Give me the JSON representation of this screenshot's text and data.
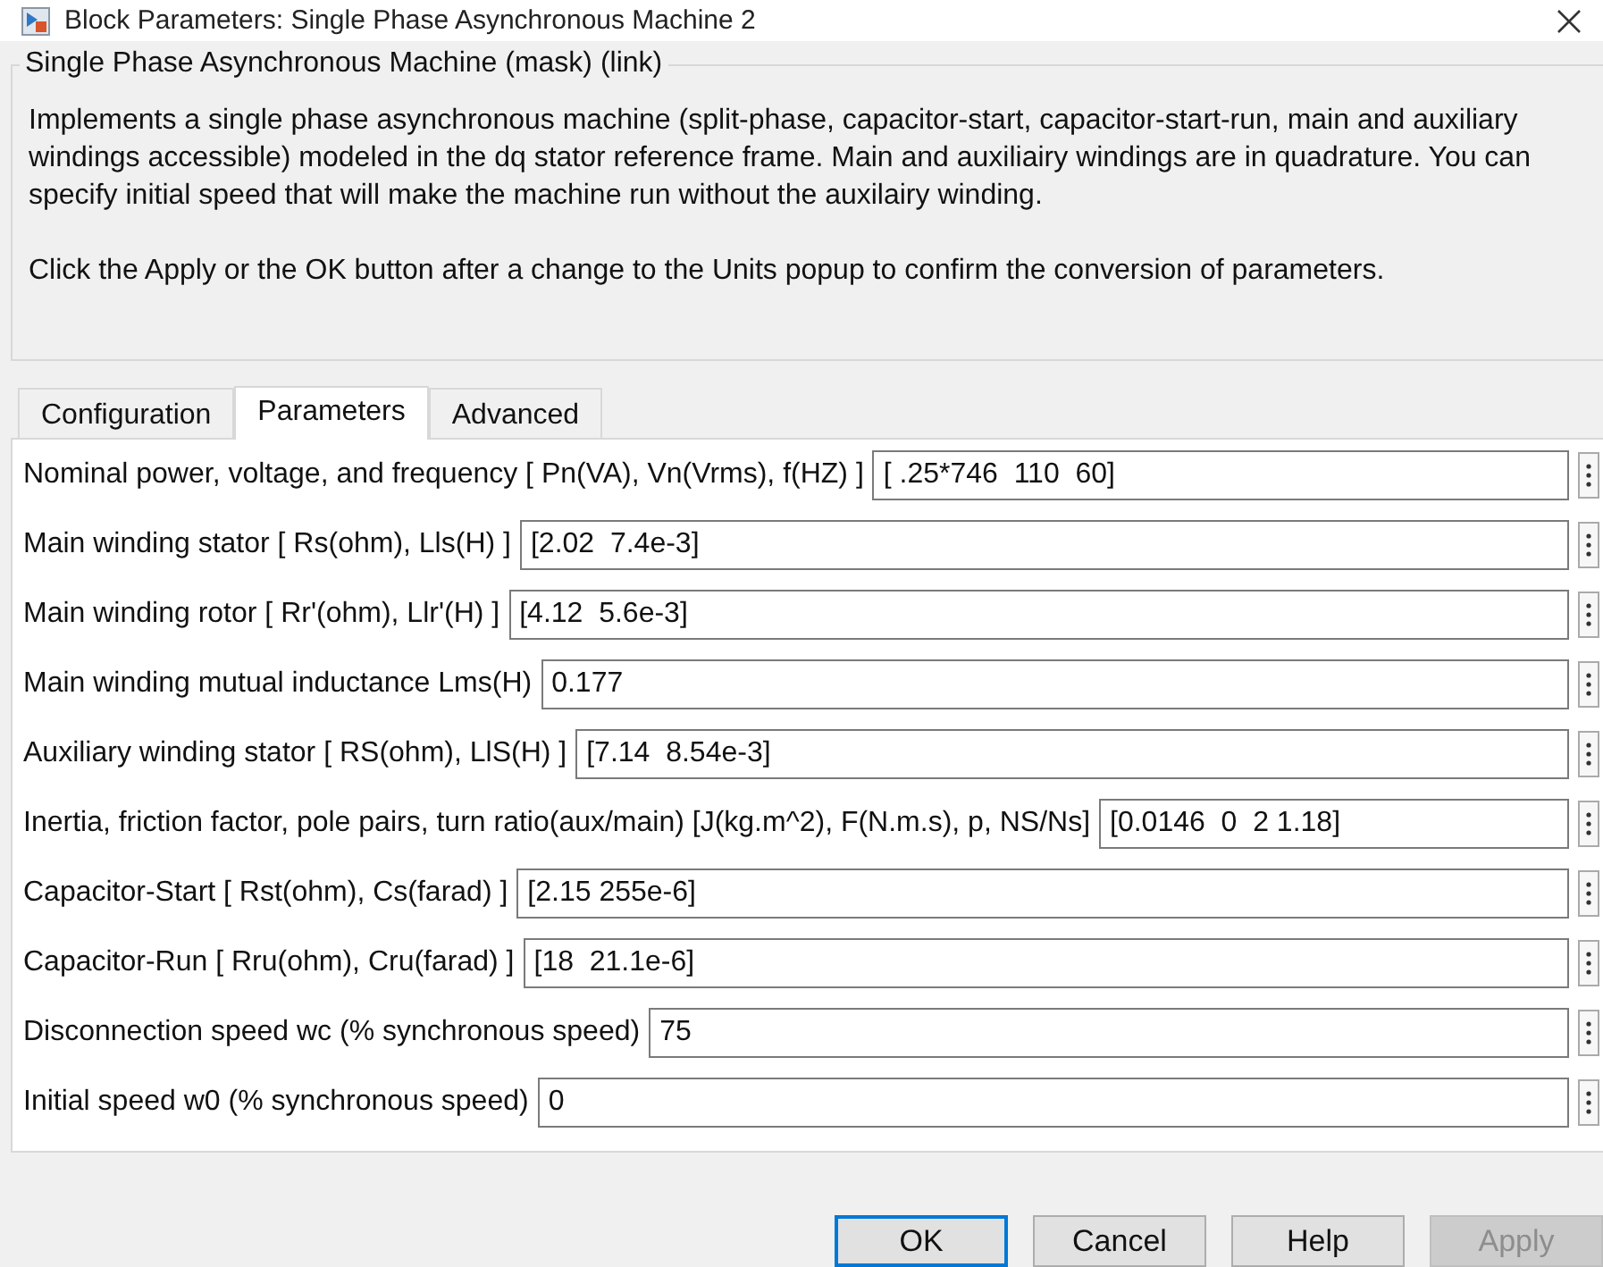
{
  "window": {
    "title": "Block Parameters: Single Phase Asynchronous Machine 2"
  },
  "group": {
    "title": "Single Phase Asynchronous Machine (mask) (link)",
    "description": [
      "Implements a single phase asynchronous machine (split-phase, capacitor-start, capacitor-start-run,  main and auxiliary windings accessible) modeled in the dq stator reference frame. Main and auxiliairy windings are in quadrature. You can specify initial speed that will make the machine run without the auxilairy winding.",
      "Click the Apply or the OK button after a change to the Units popup to confirm the conversion of parameters."
    ]
  },
  "tabs": [
    {
      "label": "Configuration",
      "selected": false
    },
    {
      "label": "Parameters",
      "selected": true
    },
    {
      "label": "Advanced",
      "selected": false
    }
  ],
  "parameters": [
    {
      "label": "Nominal power, voltage, and frequency [ Pn(VA), Vn(Vrms), f(HZ) ]",
      "value": "[ .25*746  110  60]"
    },
    {
      "label": "Main winding stator [ Rs(ohm), Lls(H) ]",
      "value": "[2.02  7.4e-3]"
    },
    {
      "label": "Main winding rotor [ Rr'(ohm), Llr'(H) ]",
      "value": "[4.12  5.6e-3]"
    },
    {
      "label": "Main winding mutual inductance Lms(H)",
      "value": "0.177"
    },
    {
      "label": "Auxiliary  winding stator [ RS(ohm), LlS(H) ]",
      "value": "[7.14  8.54e-3]"
    },
    {
      "label": "Inertia, friction factor, pole pairs, turn ratio(aux/main) [J(kg.m^2), F(N.m.s), p, NS/Ns]",
      "value": "[0.0146  0  2 1.18]"
    },
    {
      "label": "Capacitor-Start [ Rst(ohm), Cs(farad) ]",
      "value": "[2.15 255e-6]"
    },
    {
      "label": "Capacitor-Run [ Rru(ohm), Cru(farad) ]",
      "value": "[18  21.1e-6]"
    },
    {
      "label": "Disconnection speed wc (% synchronous speed)",
      "value": "75"
    },
    {
      "label": "Initial speed w0 (% synchronous speed)",
      "value": "0"
    }
  ],
  "buttons": [
    {
      "label": "OK",
      "default": true,
      "disabled": false
    },
    {
      "label": "Cancel",
      "default": false,
      "disabled": false
    },
    {
      "label": "Help",
      "default": false,
      "disabled": false
    },
    {
      "label": "Apply",
      "default": false,
      "disabled": true
    }
  ]
}
